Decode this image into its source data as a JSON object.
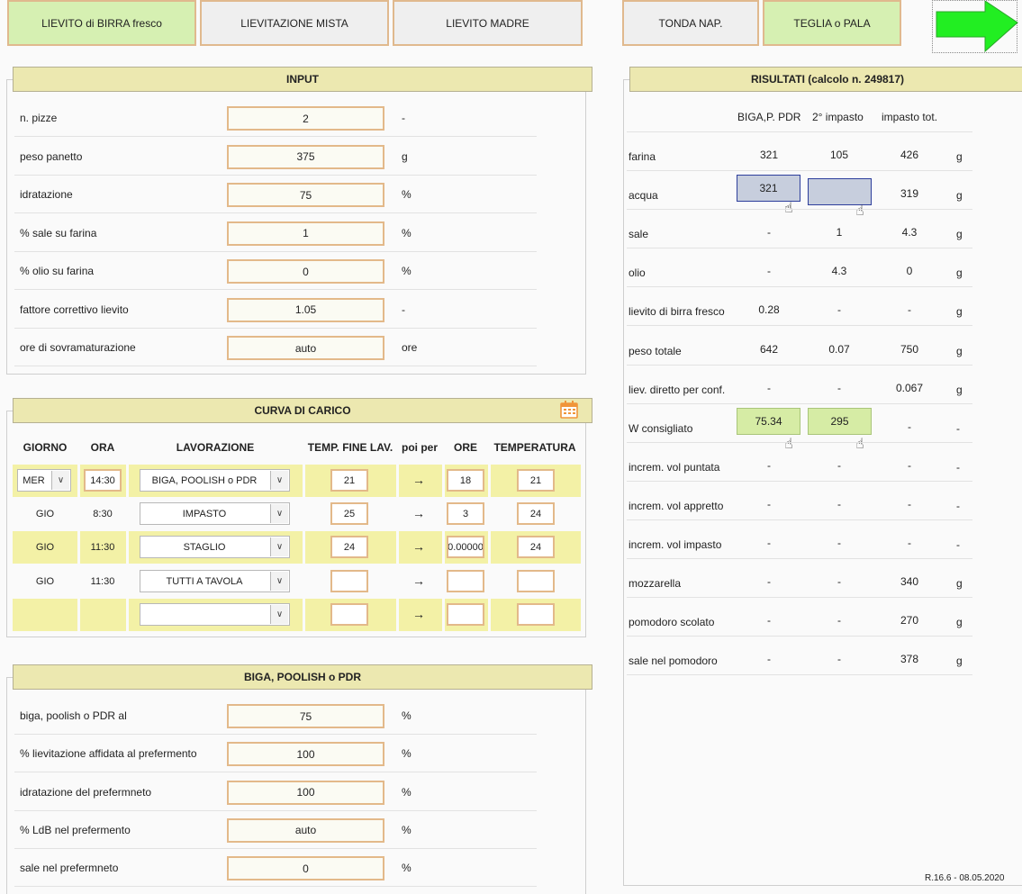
{
  "top_buttons": [
    {
      "label": "LIEVITO di BIRRA fresco"
    },
    {
      "label": "LIEVITAZIONE MISTA"
    },
    {
      "label": "LIEVITO MADRE"
    },
    {
      "label": "TONDA NAP."
    },
    {
      "label": "TEGLIA o PALA"
    }
  ],
  "next_arrow_color": "#22ee22",
  "input": {
    "title": "INPUT",
    "rows": [
      {
        "label": "n. pizze",
        "value": "2",
        "unit": "-"
      },
      {
        "label": "peso panetto",
        "value": "375",
        "unit": "g"
      },
      {
        "label": "idratazione",
        "value": "75",
        "unit": "%"
      },
      {
        "label": "% sale su farina",
        "value": "1",
        "unit": "%"
      },
      {
        "label": "% olio su farina",
        "value": "0",
        "unit": "%"
      },
      {
        "label": "fattore correttivo lievito",
        "value": "1.05",
        "unit": "-"
      },
      {
        "label": "ore di sovramaturazione",
        "value": "auto",
        "unit": "ore"
      }
    ]
  },
  "curva": {
    "title": "CURVA DI CARICO",
    "icon": "calendar-icon",
    "headers": {
      "giorno": "GIORNO",
      "ora": "ORA",
      "lavorazione": "LAVORAZIONE",
      "temp_fine": "TEMP. FINE LAV.",
      "poi_per": "poi per",
      "ore": "ORE",
      "temperatura": "TEMPERATURA"
    },
    "arrow": "→",
    "rows": [
      {
        "giorno": "MER",
        "ora": "14:30",
        "lavorazione": "BIGA, POOLISH o PDR",
        "temp": "21",
        "ore": "18",
        "temperatura": "21"
      },
      {
        "giorno": "GIO",
        "ora": "8:30",
        "lavorazione": "IMPASTO",
        "temp": "25",
        "ore": "3",
        "temperatura": "24"
      },
      {
        "giorno": "GIO",
        "ora": "11:30",
        "lavorazione": "STAGLIO",
        "temp": "24",
        "ore": "0.00000",
        "temperatura": "24"
      },
      {
        "giorno": "GIO",
        "ora": "11:30",
        "lavorazione": "TUTTI A TAVOLA",
        "temp": "",
        "ore": "",
        "temperatura": ""
      },
      {
        "giorno": "",
        "ora": "",
        "lavorazione": "",
        "temp": "",
        "ore": "",
        "temperatura": ""
      }
    ]
  },
  "biga": {
    "title": "BIGA, POOLISH o PDR",
    "rows": [
      {
        "label": "biga, poolish o PDR al",
        "value": "75",
        "unit": "%"
      },
      {
        "label": "% lievitazione affidata al prefermento",
        "value": "100",
        "unit": "%"
      },
      {
        "label": "idratazione del prefermneto",
        "value": "100",
        "unit": "%"
      },
      {
        "label": "% LdB nel prefermento",
        "value": "auto",
        "unit": "%"
      },
      {
        "label": "sale nel prefermneto",
        "value": "0",
        "unit": "%"
      }
    ]
  },
  "results": {
    "title": "RISULTATI (calcolo n. 249817)",
    "col_headers": [
      "BIGA,P. PDR",
      "2° impasto",
      "impasto tot."
    ],
    "rows": [
      {
        "label": "farina",
        "c1": "321",
        "c2": "105",
        "c3": "426",
        "unit": "g"
      },
      {
        "label": "acqua",
        "c1": "321",
        "c2": "",
        "c3": "319",
        "unit": "g"
      },
      {
        "label": "sale",
        "c1": "-",
        "c2": "1",
        "c3": "4.3",
        "unit": "g"
      },
      {
        "label": "olio",
        "c1": "-",
        "c2": "4.3",
        "c3": "0",
        "unit": "g"
      },
      {
        "label": "lievito di birra fresco",
        "c1": "0.28",
        "c2": "-",
        "c3": "-",
        "unit": "g"
      },
      {
        "label": "peso totale",
        "c1": "642",
        "c2": "0.07",
        "c3": "750",
        "unit": "g"
      },
      {
        "label": "liev. diretto per conf.",
        "c1": "-",
        "c2": "-",
        "c3": "0.067",
        "unit": "g"
      },
      {
        "label": "W consigliato",
        "c1": "75.34",
        "c2": "295",
        "c3": "-",
        "unit": "-"
      },
      {
        "label": "increm. vol puntata",
        "c1": "-",
        "c2": "-",
        "c3": "-",
        "unit": "-"
      },
      {
        "label": "increm. vol appretto",
        "c1": "-",
        "c2": "-",
        "c3": "-",
        "unit": "-"
      },
      {
        "label": "increm. vol impasto",
        "c1": "-",
        "c2": "-",
        "c3": "-",
        "unit": "-"
      },
      {
        "label": "mozzarella",
        "c1": "-",
        "c2": "-",
        "c3": "340",
        "unit": "g"
      },
      {
        "label": "pomodoro scolato",
        "c1": "-",
        "c2": "-",
        "c3": "270",
        "unit": "g"
      },
      {
        "label": "sale nel pomodoro",
        "c1": "-",
        "c2": "-",
        "c3": "378",
        "unit": "g"
      }
    ],
    "version": "R.16.6 - 08.05.2020"
  }
}
